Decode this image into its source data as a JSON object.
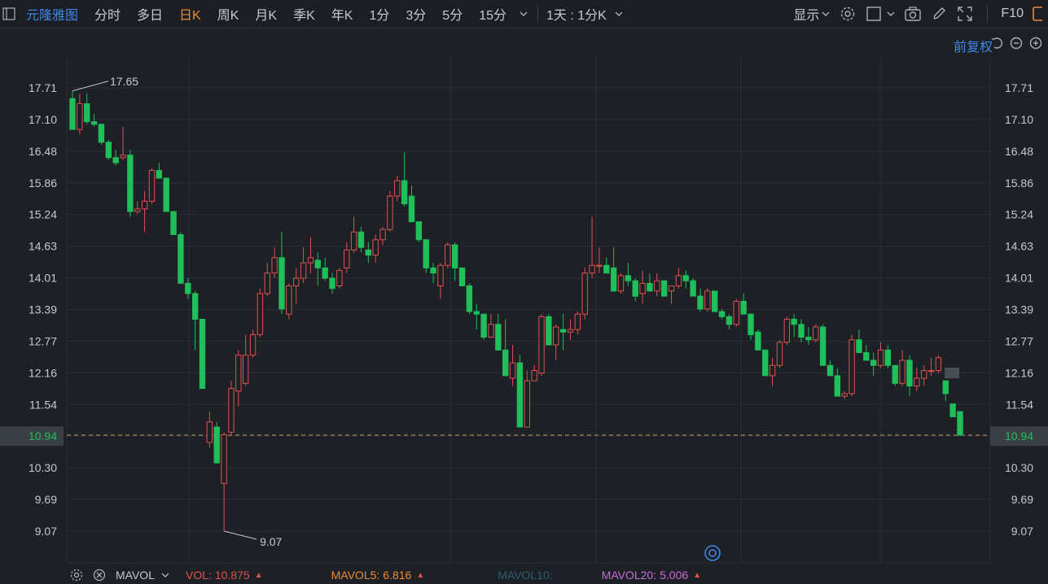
{
  "toolbar": {
    "title": "元隆雅图",
    "periods": [
      "分时",
      "多日",
      "日K",
      "周K",
      "月K",
      "季K",
      "年K",
      "1分",
      "3分",
      "5分",
      "15分"
    ],
    "active_period": "日K",
    "range_label": "1天 : 1分K",
    "display_label": "显示",
    "f10_label": "F10"
  },
  "chart": {
    "adjust_label": "前复权",
    "price_ticks": [
      "17.71",
      "17.10",
      "16.48",
      "15.86",
      "15.24",
      "14.63",
      "14.01",
      "13.39",
      "12.77",
      "12.16",
      "11.54",
      "10.94",
      "10.30",
      "9.69",
      "9.07"
    ],
    "current_price": "10.94",
    "high_label": "17.65",
    "low_label": "9.07",
    "colors": {
      "up": "#e0514d",
      "down": "#1fbf5a",
      "bg": "#1d2126",
      "grid": "#2a2f35",
      "current_box": "#3a3f46"
    }
  },
  "chart_data": {
    "type": "candlestick",
    "ylim": [
      9.07,
      17.71
    ],
    "candles": [
      [
        17.5,
        17.65,
        16.9,
        16.9
      ],
      [
        16.9,
        17.6,
        16.8,
        17.4
      ],
      [
        17.4,
        17.6,
        17.0,
        17.05
      ],
      [
        17.05,
        17.2,
        16.95,
        17.0
      ],
      [
        17.0,
        17.0,
        16.6,
        16.65
      ],
      [
        16.65,
        16.7,
        16.3,
        16.35
      ],
      [
        16.35,
        16.5,
        16.2,
        16.25
      ],
      [
        16.35,
        16.95,
        16.3,
        16.4
      ],
      [
        16.4,
        16.5,
        15.2,
        15.3
      ],
      [
        15.3,
        15.5,
        15.25,
        15.35
      ],
      [
        15.35,
        15.7,
        14.9,
        15.5
      ],
      [
        15.5,
        16.15,
        15.45,
        16.1
      ],
      [
        16.1,
        16.25,
        15.95,
        15.95
      ],
      [
        15.95,
        15.95,
        15.3,
        15.3
      ],
      [
        15.3,
        15.3,
        14.85,
        14.85
      ],
      [
        14.85,
        14.9,
        13.9,
        13.9
      ],
      [
        13.9,
        14.0,
        13.6,
        13.7
      ],
      [
        13.7,
        13.75,
        12.6,
        13.2
      ],
      [
        13.2,
        13.2,
        11.85,
        11.85
      ],
      [
        10.8,
        11.4,
        10.7,
        11.2
      ],
      [
        11.1,
        11.2,
        10.4,
        10.4
      ],
      [
        10.0,
        11.0,
        9.07,
        10.95
      ],
      [
        11.0,
        12.0,
        10.95,
        11.85
      ],
      [
        11.8,
        12.6,
        11.5,
        12.5
      ],
      [
        11.95,
        12.9,
        11.9,
        12.5
      ],
      [
        12.5,
        13.0,
        12.45,
        12.9
      ],
      [
        12.9,
        13.8,
        12.85,
        13.7
      ],
      [
        13.7,
        14.3,
        13.65,
        14.1
      ],
      [
        14.1,
        14.6,
        14.0,
        14.4
      ],
      [
        14.4,
        14.9,
        13.3,
        13.4
      ],
      [
        13.3,
        13.9,
        13.2,
        13.85
      ],
      [
        13.85,
        14.2,
        13.5,
        14.0
      ],
      [
        14.0,
        14.6,
        13.9,
        14.3
      ],
      [
        14.3,
        14.8,
        14.1,
        14.4
      ],
      [
        14.35,
        14.5,
        13.85,
        14.2
      ],
      [
        14.2,
        14.4,
        13.95,
        14.0
      ],
      [
        14.0,
        14.1,
        13.7,
        13.8
      ],
      [
        13.85,
        14.2,
        13.8,
        14.15
      ],
      [
        14.2,
        14.7,
        14.1,
        14.55
      ],
      [
        14.55,
        15.2,
        14.5,
        14.9
      ],
      [
        14.9,
        15.0,
        14.5,
        14.6
      ],
      [
        14.55,
        14.7,
        14.3,
        14.45
      ],
      [
        14.45,
        14.85,
        14.3,
        14.75
      ],
      [
        14.75,
        15.0,
        14.65,
        14.95
      ],
      [
        14.95,
        15.7,
        14.9,
        15.6
      ],
      [
        15.6,
        16.0,
        15.5,
        15.9
      ],
      [
        15.9,
        16.45,
        15.4,
        15.45
      ],
      [
        15.6,
        15.8,
        15.1,
        15.1
      ],
      [
        15.1,
        15.1,
        14.7,
        14.75
      ],
      [
        14.75,
        14.75,
        14.1,
        14.2
      ],
      [
        14.2,
        14.3,
        13.9,
        14.1
      ],
      [
        13.85,
        14.3,
        13.6,
        14.25
      ],
      [
        14.25,
        14.7,
        14.2,
        14.65
      ],
      [
        14.65,
        14.7,
        13.95,
        14.2
      ],
      [
        14.2,
        14.2,
        13.85,
        13.85
      ],
      [
        13.85,
        13.9,
        13.3,
        13.35
      ],
      [
        13.35,
        13.5,
        13.0,
        13.3
      ],
      [
        13.3,
        13.3,
        12.8,
        12.85
      ],
      [
        12.85,
        13.3,
        12.85,
        13.1
      ],
      [
        13.1,
        13.3,
        12.6,
        12.6
      ],
      [
        12.6,
        13.2,
        12.4,
        12.1
      ],
      [
        12.05,
        12.7,
        11.9,
        12.35
      ],
      [
        12.35,
        12.5,
        11.1,
        11.1
      ],
      [
        11.1,
        12.2,
        11.1,
        12.0
      ],
      [
        12.0,
        12.3,
        12.0,
        12.2
      ],
      [
        12.15,
        13.3,
        12.1,
        13.25
      ],
      [
        13.25,
        13.3,
        12.7,
        12.7
      ],
      [
        12.7,
        13.1,
        12.4,
        13.05
      ],
      [
        13.0,
        13.3,
        12.6,
        12.95
      ],
      [
        12.95,
        13.2,
        12.8,
        13.0
      ],
      [
        13.0,
        13.35,
        12.9,
        13.3
      ],
      [
        13.3,
        14.2,
        13.2,
        14.1
      ],
      [
        14.1,
        15.2,
        14.0,
        14.25
      ],
      [
        14.25,
        14.6,
        14.1,
        14.25
      ],
      [
        14.25,
        14.4,
        14.15,
        14.1
      ],
      [
        14.2,
        14.6,
        13.75,
        13.75
      ],
      [
        13.75,
        14.1,
        13.7,
        14.05
      ],
      [
        14.05,
        14.3,
        13.85,
        13.95
      ],
      [
        13.95,
        14.0,
        13.55,
        13.65
      ],
      [
        13.7,
        14.15,
        13.5,
        13.9
      ],
      [
        13.9,
        14.1,
        13.8,
        13.75
      ],
      [
        13.75,
        14.1,
        13.65,
        13.95
      ],
      [
        13.95,
        13.95,
        13.7,
        13.65
      ],
      [
        13.75,
        13.8,
        13.5,
        13.85
      ],
      [
        13.85,
        14.2,
        13.8,
        14.05
      ],
      [
        14.05,
        14.15,
        13.8,
        13.95
      ],
      [
        13.95,
        14.0,
        13.65,
        13.65
      ],
      [
        13.65,
        13.8,
        13.35,
        13.4
      ],
      [
        13.4,
        13.8,
        13.35,
        13.75
      ],
      [
        13.75,
        13.75,
        13.35,
        13.35
      ],
      [
        13.35,
        13.4,
        13.2,
        13.25
      ],
      [
        13.25,
        13.3,
        13.0,
        13.1
      ],
      [
        13.1,
        13.6,
        13.05,
        13.55
      ],
      [
        13.55,
        13.7,
        13.3,
        13.3
      ],
      [
        13.3,
        13.3,
        12.8,
        12.9
      ],
      [
        12.95,
        13.0,
        12.6,
        12.6
      ],
      [
        12.6,
        12.6,
        12.1,
        12.1
      ],
      [
        12.1,
        12.45,
        11.9,
        12.3
      ],
      [
        12.3,
        12.8,
        12.25,
        12.75
      ],
      [
        12.75,
        13.25,
        12.7,
        13.2
      ],
      [
        13.2,
        13.3,
        12.85,
        13.1
      ],
      [
        13.1,
        13.2,
        12.75,
        12.85
      ],
      [
        12.85,
        13.05,
        12.7,
        12.8
      ],
      [
        12.8,
        13.1,
        12.75,
        13.05
      ],
      [
        13.05,
        13.1,
        12.3,
        12.3
      ],
      [
        12.3,
        12.4,
        12.1,
        12.1
      ],
      [
        12.1,
        12.25,
        11.7,
        11.7
      ],
      [
        11.7,
        11.8,
        11.65,
        11.75
      ],
      [
        11.75,
        12.9,
        11.7,
        12.8
      ],
      [
        12.8,
        13.0,
        12.55,
        12.55
      ],
      [
        12.55,
        12.7,
        12.45,
        12.4
      ],
      [
        12.4,
        12.55,
        12.1,
        12.3
      ],
      [
        12.3,
        12.75,
        12.25,
        12.6
      ],
      [
        12.6,
        12.7,
        12.25,
        12.3
      ],
      [
        12.3,
        12.3,
        11.9,
        11.95
      ],
      [
        11.95,
        12.6,
        11.9,
        12.4
      ],
      [
        12.4,
        12.5,
        11.7,
        11.9
      ],
      [
        11.9,
        12.25,
        11.8,
        12.05
      ],
      [
        12.05,
        12.3,
        11.9,
        12.2
      ],
      [
        12.2,
        12.45,
        12.1,
        12.2
      ],
      [
        12.2,
        12.5,
        12.15,
        12.45
      ],
      [
        12.0,
        12.0,
        11.6,
        11.75
      ],
      [
        11.55,
        11.55,
        11.3,
        11.3
      ],
      [
        11.4,
        11.4,
        10.94,
        10.94
      ]
    ]
  },
  "bottom": {
    "mavol_label": "MAVOL",
    "vol_label": "VOL:",
    "vol_value": "10.875",
    "mavol5_label": "MAVOL5:",
    "mavol5_value": "6.816",
    "mavol10_label": "MAVOL10:",
    "mavol20_label": "MAVOL20:",
    "mavol20_value": "5.006"
  }
}
